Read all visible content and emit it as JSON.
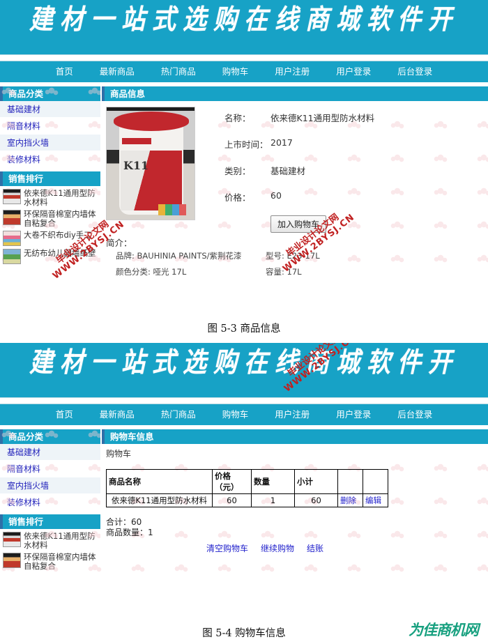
{
  "site": {
    "banner_title": "建材一站式选购在线商城软件开",
    "nav": [
      "首页",
      "最新商品",
      "热门商品",
      "购物车",
      "用户注册",
      "用户登录",
      "后台登录"
    ],
    "accent_color": "#17a2c6",
    "link_color": "#2222cc"
  },
  "sidebar": {
    "category_head": "商品分类",
    "categories": [
      "基础建材",
      "隔音材料",
      "室内挡火墙",
      "装修材料"
    ],
    "rank_head": "销售排行",
    "rank_items": [
      "依来德K11通用型防水材料",
      "环保隔音棉室内墙体自粘复合",
      "大卷不织布diy手工",
      "无纺布幼儿园墙纸壁"
    ],
    "rank_items_short": [
      "依来德K11通用型防水材料",
      "环保隔音棉室内墙体自粘复合"
    ]
  },
  "product_page": {
    "panel_title": "商品信息",
    "fields": [
      {
        "label": "名称：",
        "value": "依来德K11通用型防水材料"
      },
      {
        "label": "上市时间：",
        "value": "2017"
      },
      {
        "label": "类别：",
        "value": "基础建材"
      },
      {
        "label": "价格：",
        "value": "60"
      }
    ],
    "add_to_cart_label": "加入购物车",
    "intro_label": "简介：",
    "intro": [
      {
        "a": "品牌: BAUHINIA PAINTS/紫荆花漆",
        "b": "型号: E23-17L"
      },
      {
        "a": "颜色分类: 哑光 17L",
        "b": "容量: 17L"
      }
    ],
    "image_alt_text": "K11",
    "caption": "图 5-3 商品信息"
  },
  "cart_page": {
    "panel_title": "购物车信息",
    "sub_title": "购物车",
    "columns": [
      "商品名称",
      "价格\n（元）",
      "数量",
      "小计",
      "",
      ""
    ],
    "column_price_line1": "价格",
    "column_price_line2": "（元）",
    "rows": [
      {
        "name": "依来德K11通用型防水材料",
        "price": "60",
        "qty": "1",
        "subtotal": "60",
        "delete_label": "删除",
        "edit_label": "编辑"
      }
    ],
    "total_line": "合计：60",
    "count_line": "商品数量：1",
    "actions": [
      "清空购物车",
      "继续购物",
      "结账"
    ],
    "caption": "图 5-4 购物车信息"
  },
  "watermark": {
    "line1": "毕业设计论文网",
    "line2": "WWW.2BYSJ.CN"
  },
  "footer_brand": "为佳商机网"
}
